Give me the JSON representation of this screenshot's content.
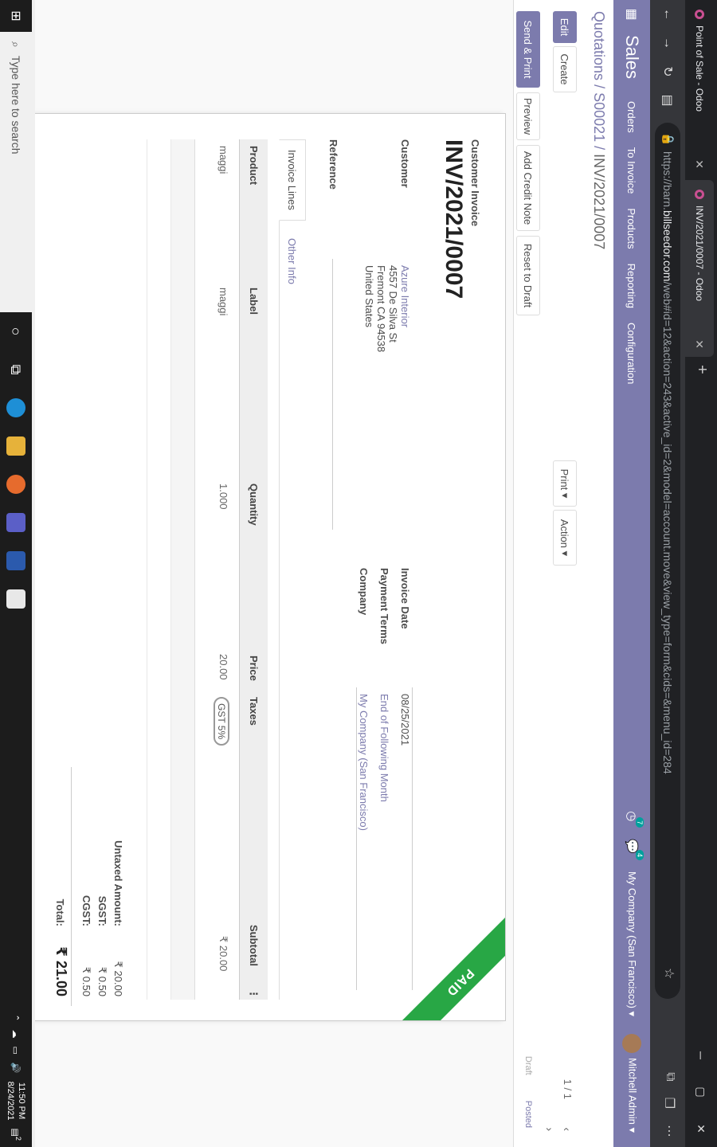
{
  "browser": {
    "tabs": [
      {
        "title": "Point of Sale - Odoo"
      },
      {
        "title": "INV/2021/0007 - Odoo"
      }
    ],
    "url_prefix": "https://barn.",
    "url_domain": "billseedor.com",
    "url_rest": "/web#id=12&action=243&active_id=2&model=account.move&view_type=form&cids=&menu_id=284"
  },
  "odoo_nav": {
    "app": "Sales",
    "menu": [
      "Orders",
      "To Invoice",
      "Products",
      "Reporting",
      "Configuration"
    ],
    "activity_count": "7",
    "message_count": "4",
    "company": "My Company (San Francisco)",
    "user": "Mitchell Admin"
  },
  "breadcrumb": {
    "part1": "Quotations",
    "part2": "S00021",
    "current": "INV/2021/0007",
    "sep": " / "
  },
  "buttons": {
    "edit": "Edit",
    "create": "Create",
    "print": "Print",
    "action": "Action",
    "send_print": "Send & Print",
    "preview": "Preview",
    "credit_note": "Add Credit Note",
    "reset_draft": "Reset to Draft"
  },
  "pager": "1 / 1",
  "status": {
    "draft": "Draft",
    "posted": "Posted"
  },
  "ribbon": "PAID",
  "invoice": {
    "type_label": "Customer Invoice",
    "number": "INV/2021/0007",
    "customer_label": "Customer",
    "customer_name": "Azure Interior",
    "address_lines": [
      "4557 De Silva St",
      "Fremont CA 94538",
      "United States"
    ],
    "reference_label": "Reference",
    "invoice_date_label": "Invoice Date",
    "invoice_date": "08/25/2021",
    "payment_terms_label": "Payment Terms",
    "payment_terms": "End of Following Month",
    "company_label": "Company",
    "company": "My Company (San Francisco)"
  },
  "tabs": {
    "invoice_lines": "Invoice Lines",
    "other_info": "Other Info"
  },
  "table": {
    "headers": {
      "product": "Product",
      "label": "Label",
      "quantity": "Quantity",
      "price": "Price",
      "taxes": "Taxes",
      "subtotal": "Subtotal"
    },
    "rows": [
      {
        "product": "maggi",
        "label": "maggi",
        "quantity": "1.000",
        "price": "20.00",
        "taxes": "GST 5%",
        "subtotal": "₹ 20.00"
      }
    ]
  },
  "totals": {
    "untaxed_label": "Untaxed Amount:",
    "untaxed": "₹ 20.00",
    "sgst_label": "SGST:",
    "sgst": "₹ 0.50",
    "cgst_label": "CGST:",
    "cgst": "₹ 0.50",
    "total_label": "Total:",
    "total": "₹ 21.00"
  },
  "taskbar": {
    "search_placeholder": "Type here to search",
    "time": "11:50 PM",
    "date": "8/24/2021",
    "notif_count": "2"
  }
}
